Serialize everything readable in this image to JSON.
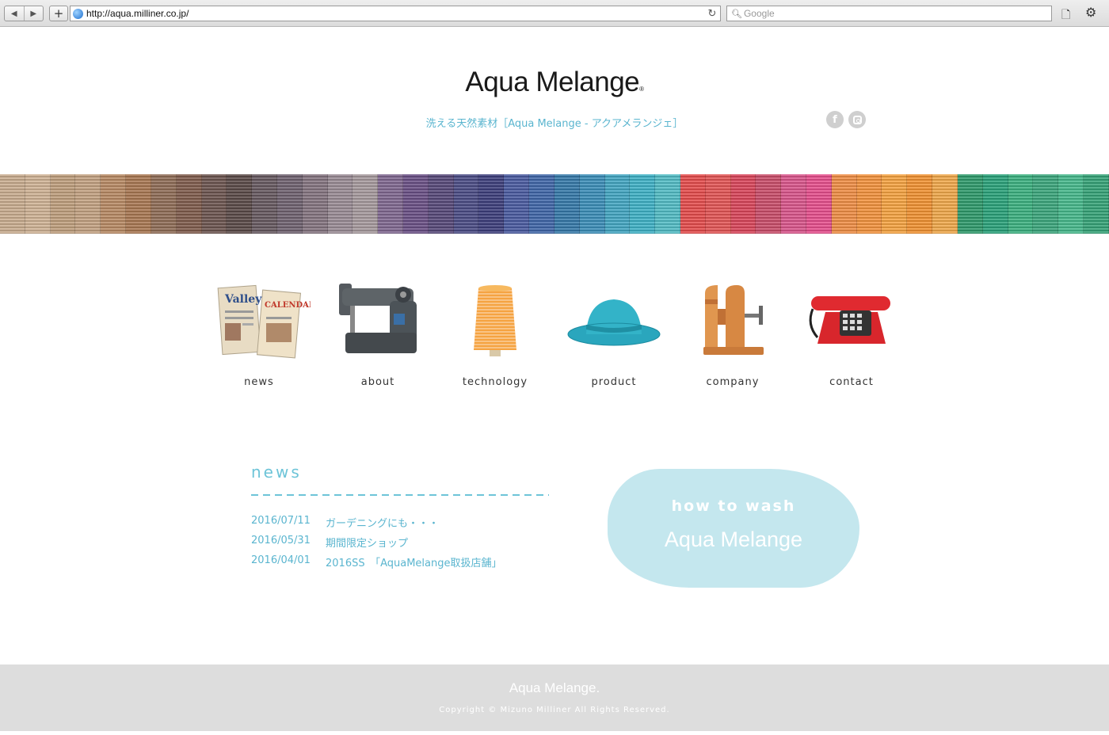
{
  "browser": {
    "url": "http://aqua.milliner.co.jp/",
    "search_placeholder": "Google",
    "back_glyph": "◀",
    "forward_glyph": "▶",
    "add_glyph": "+",
    "reload_glyph": "↻",
    "search_glyph": "🔍︎",
    "page_glyph": "🗋",
    "gear_glyph": "⚙"
  },
  "header": {
    "logo": "Aqua Melange",
    "logo_mark": "®",
    "tagline": "洗える天然素材［Aqua Melange - アクアメランジェ］",
    "social": {
      "facebook": "f"
    }
  },
  "banner": {
    "colors": [
      "#c9ad8f",
      "#cfb395",
      "#bf9f7d",
      "#c3a282",
      "#b88a64",
      "#a97752",
      "#8f6d57",
      "#7f5c4c",
      "#6c5550",
      "#5a4a48",
      "#675960",
      "#6f6270",
      "#84747f",
      "#9a8c95",
      "#a69a9d",
      "#7f6890",
      "#6a5085",
      "#574979",
      "#4b4c85",
      "#3e3f7c",
      "#4a5ba0",
      "#4066a8",
      "#3679a9",
      "#3b8eb8",
      "#43a6c2",
      "#3fb2c6",
      "#52bcc5",
      "#e54c4c",
      "#e25555",
      "#d9455a",
      "#c94d6a",
      "#d9558b",
      "#e64f8d",
      "#ef8e45",
      "#f3933e",
      "#f5a341",
      "#f19232",
      "#f0a84b",
      "#2f9a6b",
      "#2aa27a",
      "#3bb07f",
      "#3ba67c",
      "#46b88b",
      "#36a377"
    ]
  },
  "nav": [
    {
      "label": "news",
      "icon": "newspaper-icon"
    },
    {
      "label": "about",
      "icon": "sewing-machine-icon"
    },
    {
      "label": "technology",
      "icon": "yarn-cone-icon"
    },
    {
      "label": "product",
      "icon": "hat-icon"
    },
    {
      "label": "company",
      "icon": "hat-block-icon"
    },
    {
      "label": "contact",
      "icon": "telephone-icon"
    }
  ],
  "newspaper_text": {
    "a": "Valley",
    "b": "CALENDAR"
  },
  "news": {
    "title": "news",
    "items": [
      {
        "date": "2016/07/11",
        "text": "ガーデニングにも・・・"
      },
      {
        "date": "2016/05/31",
        "text": "期間限定ショップ"
      },
      {
        "date": "2016/04/01",
        "text": "2016SS　「AquaMelange取扱店舗」"
      }
    ]
  },
  "wash": {
    "small": "how to wash",
    "logo": "Aqua Melange"
  },
  "footer": {
    "logo": "Aqua Melange.",
    "copyright": "Copyright © Mizuno Milliner All Rights Reserved."
  }
}
